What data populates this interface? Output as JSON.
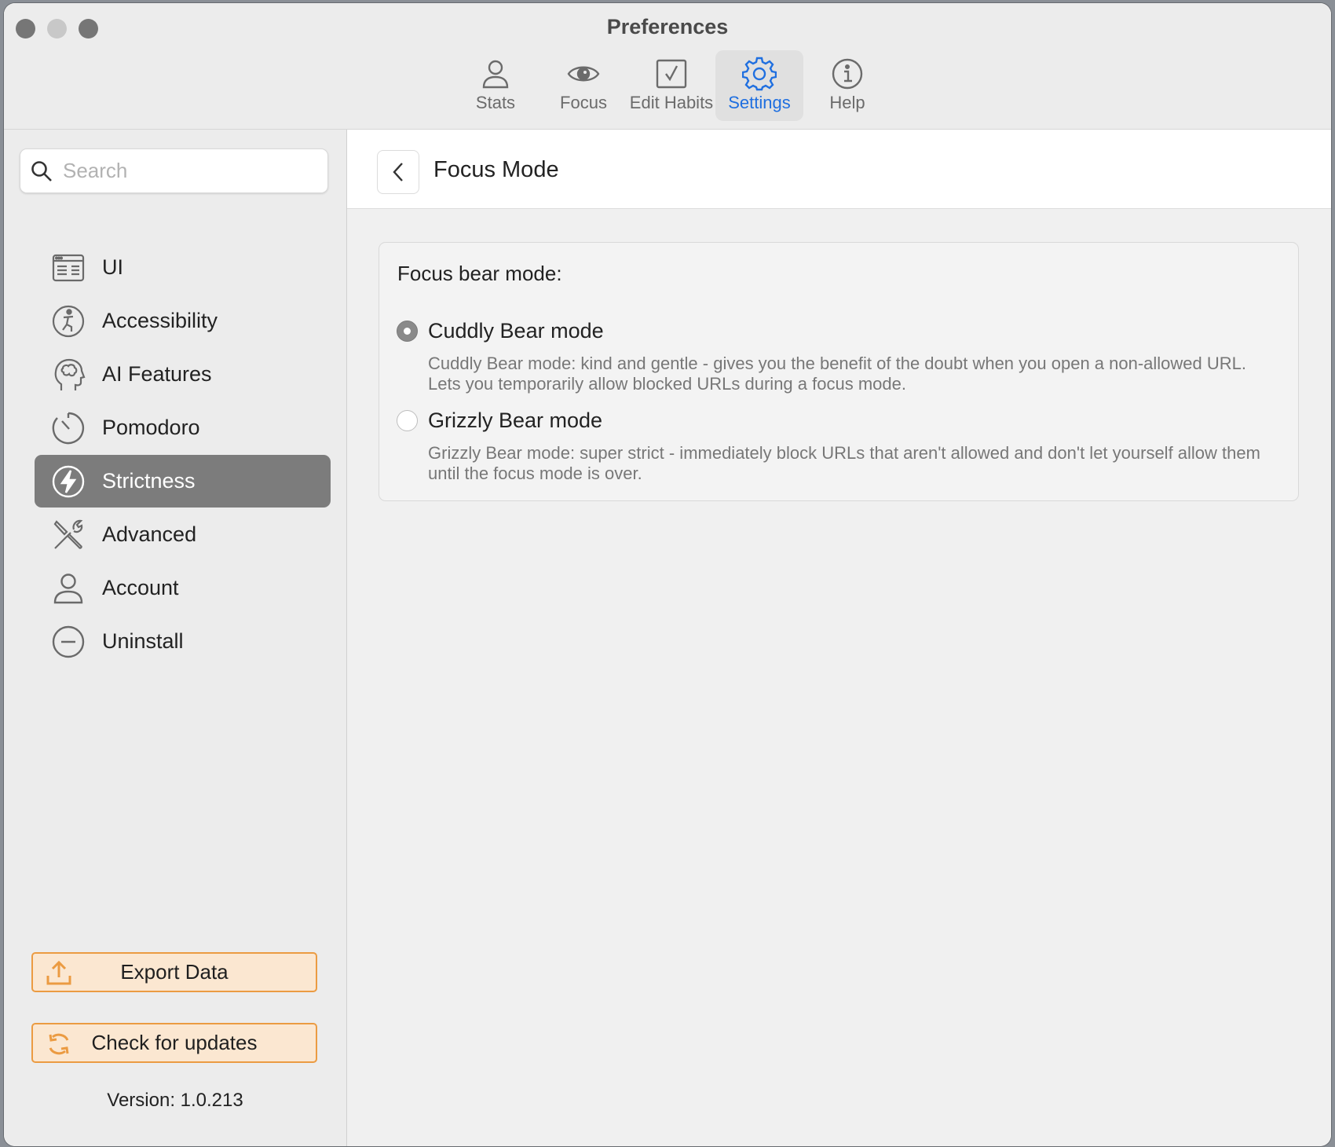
{
  "window": {
    "title": "Preferences"
  },
  "toolbar": {
    "tabs": [
      {
        "label": "Stats",
        "icon": "person-icon"
      },
      {
        "label": "Focus",
        "icon": "eye-icon"
      },
      {
        "label": "Edit Habits",
        "icon": "checkbox-icon"
      },
      {
        "label": "Settings",
        "icon": "gear-icon",
        "active": true
      },
      {
        "label": "Help",
        "icon": "info-icon"
      }
    ],
    "active_color": "#1f6fe0"
  },
  "sidebar": {
    "search": {
      "placeholder": "Search",
      "value": ""
    },
    "items": [
      {
        "label": "UI",
        "icon": "ui-window-icon"
      },
      {
        "label": "Accessibility",
        "icon": "accessibility-icon"
      },
      {
        "label": "AI Features",
        "icon": "brain-head-icon"
      },
      {
        "label": "Pomodoro",
        "icon": "timer-icon"
      },
      {
        "label": "Strictness",
        "icon": "bolt-icon",
        "selected": true
      },
      {
        "label": "Advanced",
        "icon": "tools-icon"
      },
      {
        "label": "Account",
        "icon": "person-icon"
      },
      {
        "label": "Uninstall",
        "icon": "minus-circle-icon"
      }
    ],
    "export_label": "Export Data",
    "updates_label": "Check for updates",
    "version": "Version: 1.0.213",
    "button_accent": "#eb9b42"
  },
  "main": {
    "title": "Focus Mode",
    "panel": {
      "heading": "Focus bear mode:",
      "options": [
        {
          "label": "Cuddly Bear mode",
          "description": "Cuddly Bear mode: kind and gentle - gives you the benefit of the doubt when you open a non-allowed URL. Lets you temporarily allow blocked URLs during a focus mode.",
          "selected": true
        },
        {
          "label": "Grizzly Bear mode",
          "description": "Grizzly Bear mode: super strict - immediately block URLs that aren't allowed and don't let yourself allow them until the focus mode is over.",
          "selected": false
        }
      ]
    }
  }
}
